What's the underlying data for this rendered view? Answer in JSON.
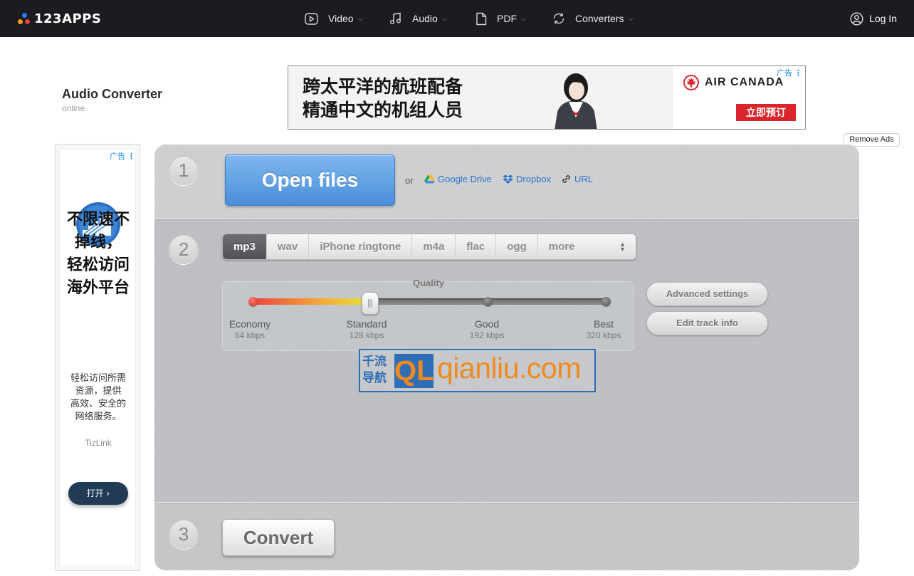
{
  "nav": {
    "logo": "123APPS",
    "items": [
      {
        "label": "Video",
        "icon": "play-icon"
      },
      {
        "label": "Audio",
        "icon": "music-note-icon"
      },
      {
        "label": "PDF",
        "icon": "document-icon"
      },
      {
        "label": "Converters",
        "icon": "refresh-icon"
      }
    ],
    "login": "Log In"
  },
  "header": {
    "title": "Audio Converter",
    "subtitle": "online"
  },
  "top_ad": {
    "line1": "跨太平洋的航班配备",
    "line2": "精通中文的机组人员",
    "brand": "AIR CANADA",
    "cta": "立即预订",
    "tag": "广告"
  },
  "remove_ads": "Remove Ads",
  "side_ad": {
    "tag": "广告",
    "headline1": "不限速不",
    "headline2": "掉线，",
    "headline3": "轻松访问",
    "headline4": "海外平台",
    "body1": "轻松访问所需",
    "body2": "资源，提供",
    "body3": "高效、安全的",
    "body4": "网络服务。",
    "brand": "TizLink",
    "cta": "打开"
  },
  "step1": {
    "number": "1",
    "open_files": "Open files",
    "or": "or",
    "sources": [
      "Google Drive",
      "Dropbox",
      "URL"
    ]
  },
  "step2": {
    "number": "2",
    "formats": [
      "mp3",
      "wav",
      "iPhone ringtone",
      "m4a",
      "flac",
      "ogg",
      "more"
    ],
    "selected_format": "mp3",
    "quality_title": "Quality",
    "quality_levels": [
      {
        "name": "Economy",
        "rate": "64 kbps"
      },
      {
        "name": "Standard",
        "rate": "128 kbps"
      },
      {
        "name": "Good",
        "rate": "192 kbps"
      },
      {
        "name": "Best",
        "rate": "320 kbps"
      }
    ],
    "selected_quality_index": 1,
    "advanced_settings": "Advanced settings",
    "edit_track_info": "Edit track info"
  },
  "watermark": {
    "cn1": "千流",
    "cn2": "导航",
    "logo": "QL",
    "url": "qianliu.com"
  },
  "step3": {
    "number": "3",
    "convert": "Convert"
  },
  "colors": {
    "nav_bg": "#1b1c1f",
    "open_button": "#5b9de3",
    "link": "#2b73c7",
    "watermark_blue": "#2f6db7",
    "watermark_orange": "#f08a1f"
  }
}
